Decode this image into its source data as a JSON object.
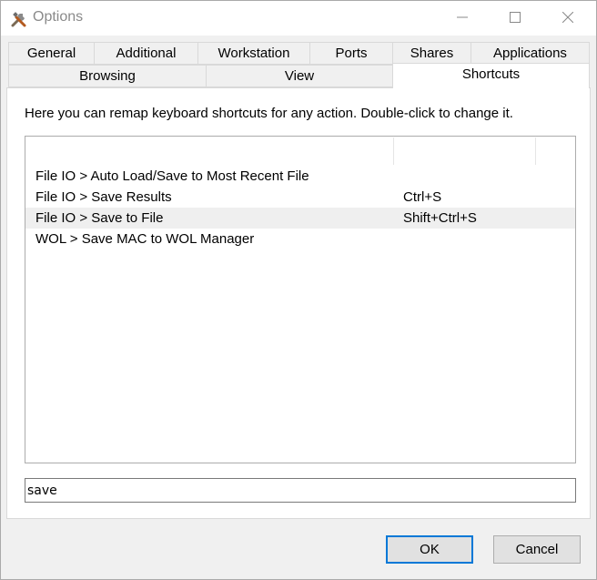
{
  "window": {
    "title": "Options",
    "icon": "tools-icon",
    "controls": [
      "minimize-icon",
      "maximize-icon",
      "close-icon"
    ]
  },
  "tabs": {
    "row1": [
      {
        "label": "General"
      },
      {
        "label": "Additional"
      },
      {
        "label": "Workstation"
      },
      {
        "label": "Ports"
      },
      {
        "label": "Shares"
      },
      {
        "label": "Applications"
      }
    ],
    "row2": [
      {
        "label": "Browsing"
      },
      {
        "label": "View"
      },
      {
        "label": "Shortcuts",
        "active": true
      }
    ]
  },
  "shortcuts": {
    "intro": "Here you can remap keyboard shortcuts for any action. Double-click to change it.",
    "rows": [
      {
        "action": "File IO > Auto Load/Save to Most Recent File",
        "shortcut": ""
      },
      {
        "action": "File IO > Save Results",
        "shortcut": "Ctrl+S"
      },
      {
        "action": "File IO > Save to File",
        "shortcut": "Shift+Ctrl+S",
        "selected": true
      },
      {
        "action": "WOL > Save MAC to WOL Manager",
        "shortcut": ""
      }
    ],
    "filter_value": "save"
  },
  "buttons": {
    "ok": "OK",
    "cancel": "Cancel"
  },
  "colors": {
    "focus_accent": "#0078d7",
    "selected_row": "#efefef"
  }
}
